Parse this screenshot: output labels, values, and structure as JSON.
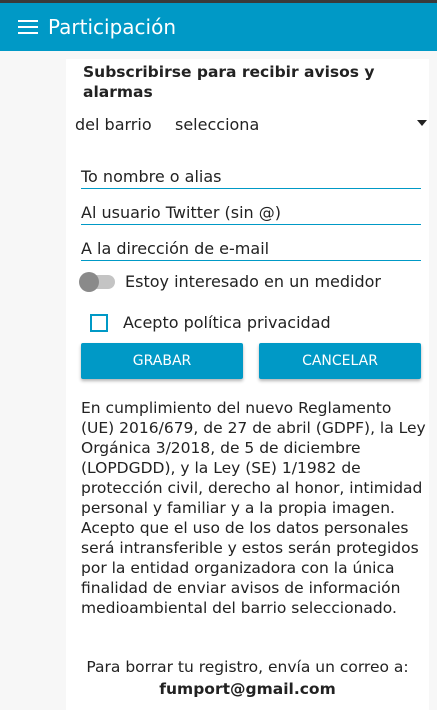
{
  "app": {
    "title": "Participación",
    "menu_icon": "hamburger-icon"
  },
  "form": {
    "heading": "Subscribirse para recibir avisos y alarmas",
    "barrio_label": "del barrio",
    "barrio_value": "selecciona",
    "name_placeholder": "To nombre o alias",
    "twitter_placeholder": "Al usuario Twitter (sin @)",
    "email_placeholder": "A la dirección de e-mail",
    "medidor_label": "Estoy interesado en un medidor",
    "medidor_on": false,
    "privacy_label": "Acepto política privacidad",
    "privacy_checked": false,
    "save_label": "GRABAR",
    "cancel_label": "CANCELAR"
  },
  "legal_text": "En cumplimiento del nuevo Reglamento (UE) 2016/679, de 27 de abril (GDPF), la Ley Orgánica 3/2018, de 5 de diciembre (LOPDGDD), y la Ley (SE) 1/1982 de protección civil, derecho al honor, intimidad personal y familiar y a la propia imagen. Acepto que el uso de los datos personales será intransferible y estos serán protegidos por la entidad organizadora con la única finalidad de enviar avisos de información medioambiental del barrio seleccionado.",
  "footer": {
    "text": "Para borrar tu registro, envía un correo a:",
    "email": "fumport@gmail.com"
  },
  "colors": {
    "primary": "#0099c6"
  }
}
